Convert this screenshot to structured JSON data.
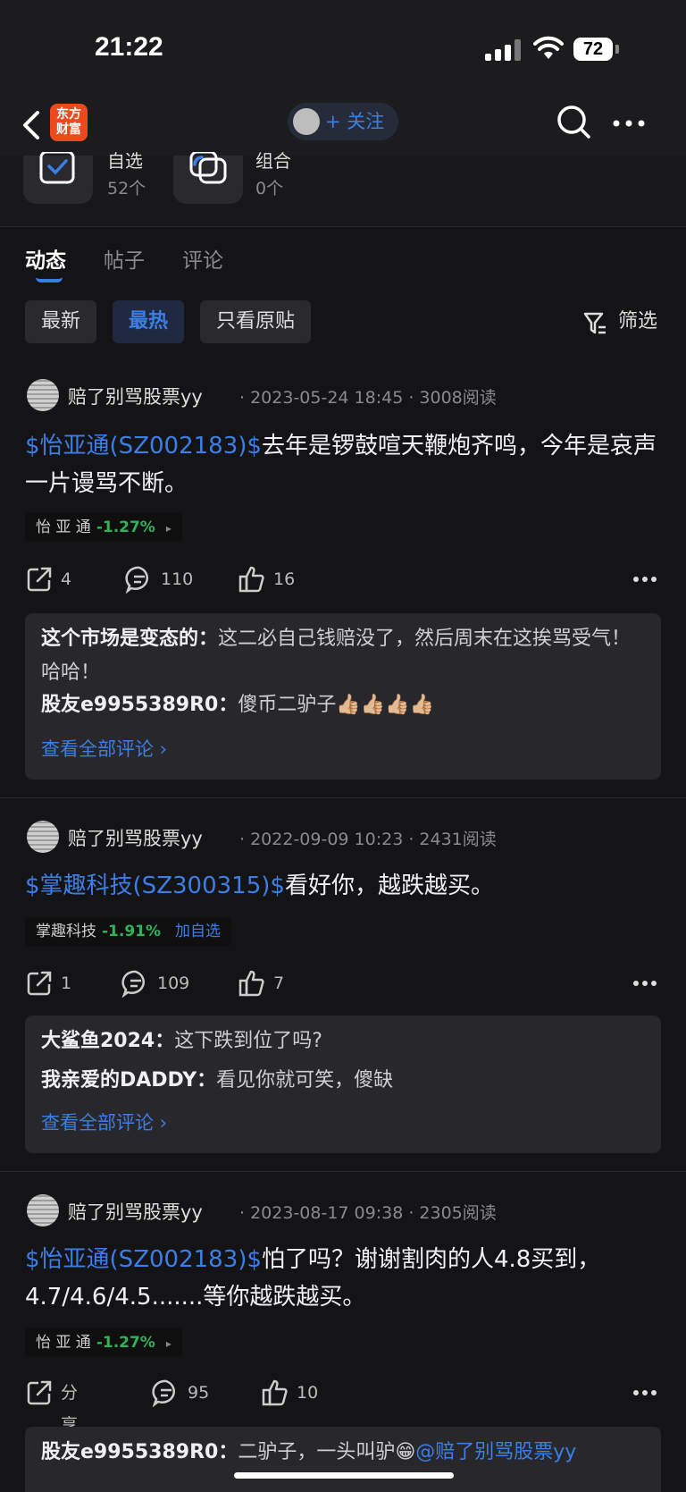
{
  "status": {
    "time": "21:22",
    "battery": "72"
  },
  "nav": {
    "logo_line1": "东方",
    "logo_line2": "财富",
    "follow_label": "+ 关注"
  },
  "profile": {
    "watch": {
      "name": "自选",
      "count": "52个"
    },
    "combo": {
      "name": "组合",
      "count": "0个"
    }
  },
  "tabs": [
    "动态",
    "帖子",
    "评论"
  ],
  "filters": [
    "最新",
    "最热",
    "只看原贴"
  ],
  "filter_button": "筛选",
  "posts": [
    {
      "user": "赔了别骂股票yy",
      "meta": "· 2023-05-24 18:45 · 3008阅读",
      "tag": "$怡亚通(SZ002183)$",
      "text": "去年是锣鼓喧天鞭炮齐鸣，今年是哀声一片谩骂不断。",
      "stock_name": "怡 亚 通",
      "stock_change": "-1.27%",
      "stock_action": "▸",
      "shares": "4",
      "comments": "110",
      "likes": "16",
      "replies": [
        {
          "author": "这个市场是变态的：",
          "text": "这二必自己钱赔没了，然后周末在这挨骂受气！哈哈！"
        },
        {
          "author": "股友e9955389R0：",
          "text": "傻币二驴子👍🏼👍🏼👍🏼👍🏼"
        }
      ],
      "view_all": "查看全部评论 ›"
    },
    {
      "user": "赔了别骂股票yy",
      "meta": "· 2022-09-09 10:23 · 2431阅读",
      "tag": "$掌趣科技(SZ300315)$",
      "text": "看好你，越跌越买。",
      "stock_name": "掌趣科技",
      "stock_change": "-1.91%",
      "stock_action": "加自选",
      "shares": "1",
      "comments": "109",
      "likes": "7",
      "replies": [
        {
          "author": "大鲨鱼2024：",
          "text": "这下跌到位了吗?"
        },
        {
          "author": "我亲爱的DADDY：",
          "text": "看见你就可笑，傻缺"
        }
      ],
      "view_all": "查看全部评论 ›"
    },
    {
      "user": "赔了别骂股票yy",
      "meta": "· 2023-08-17 09:38 · 2305阅读",
      "tag": "$怡亚通(SZ002183)$",
      "text": "怕了吗？谢谢割肉的人4.8买到，4.7/4.6/4.5.......等你越跌越买。",
      "stock_name": "怡 亚 通",
      "stock_change": "-1.27%",
      "stock_action": "▸",
      "shares": "分享",
      "comments": "95",
      "likes": "10",
      "replies": [
        {
          "author": "股友e9955389R0：",
          "text": "二驴子，一头叫驴😁",
          "mention": "@赔了别骂股票yy"
        }
      ]
    }
  ]
}
